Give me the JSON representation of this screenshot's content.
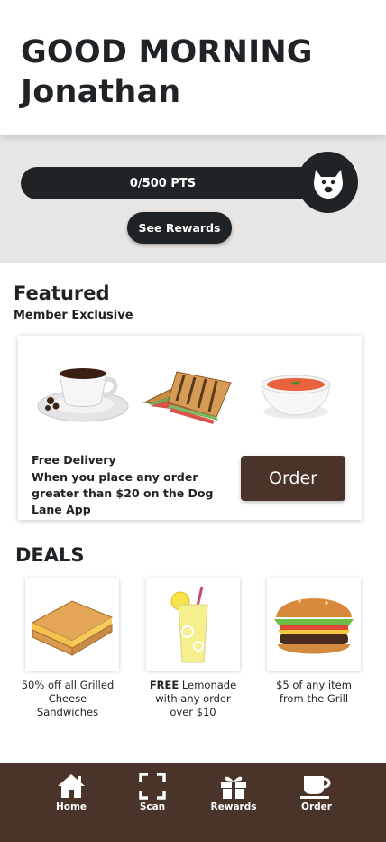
{
  "header": {
    "greeting": "GOOD MORNING",
    "name": "Jonathan"
  },
  "points": {
    "label": "0/500 PTS",
    "current": 0,
    "goal": 500,
    "rewards_button": "See Rewards"
  },
  "featured": {
    "title": "Featured",
    "subtitle": "Member Exclusive",
    "images": [
      "coffee-cup",
      "grilled-sandwich",
      "tomato-soup"
    ],
    "promo_heading": "Free Delivery",
    "promo_body": "When you place any order greater than $20 on the Dog Lane App",
    "order_button": "Order"
  },
  "deals": {
    "title": "DEALS",
    "items": [
      {
        "image": "grilled-cheese",
        "bold": "",
        "text": "50% off all Grilled Cheese Sandwiches"
      },
      {
        "image": "lemonade",
        "bold": "FREE",
        "text": " Lemonade with any order over $10"
      },
      {
        "image": "burger",
        "bold": "",
        "text": "$5 of any item from the Grill"
      }
    ]
  },
  "nav": {
    "items": [
      {
        "label": "Home",
        "icon": "home-icon"
      },
      {
        "label": "Scan",
        "icon": "scan-icon"
      },
      {
        "label": "Rewards",
        "icon": "gift-icon"
      },
      {
        "label": "Order",
        "icon": "cup-icon"
      }
    ]
  },
  "colors": {
    "dark": "#1f2326",
    "brown": "#4a3329",
    "band": "#e8e6e4"
  }
}
